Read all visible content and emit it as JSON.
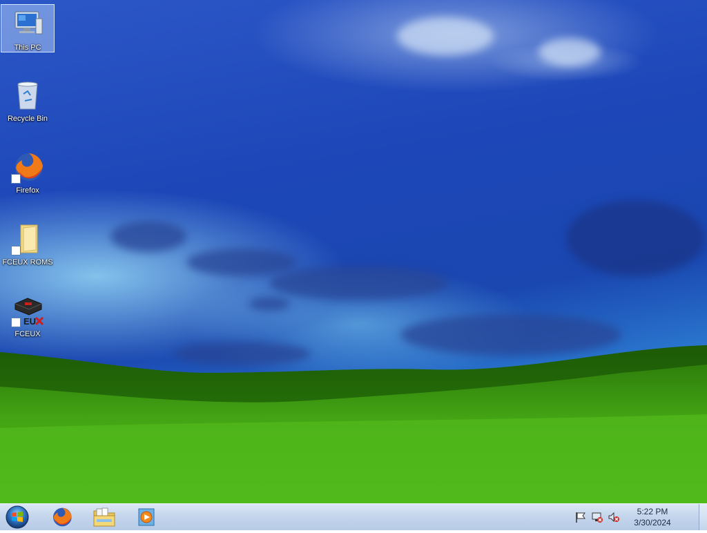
{
  "desktop": {
    "icons": [
      {
        "label": "This PC",
        "icon": "computer-icon",
        "selected": true
      },
      {
        "label": "Recycle Bin",
        "icon": "recycle-bin-icon",
        "selected": false
      },
      {
        "label": "Firefox",
        "icon": "firefox-icon",
        "selected": false
      },
      {
        "label": "FCEUX ROMS",
        "icon": "folder-icon",
        "selected": false
      },
      {
        "label": "FCEUX",
        "icon": "fceux-icon",
        "selected": false
      }
    ]
  },
  "taskbar": {
    "pinned": [
      {
        "name": "firefox",
        "icon": "firefox-icon"
      },
      {
        "name": "file-explorer",
        "icon": "folder-icon"
      },
      {
        "name": "media-player",
        "icon": "media-player-icon"
      }
    ],
    "tray": {
      "icons": [
        "action-center-flag-icon",
        "network-icon",
        "volume-muted-icon"
      ],
      "time": "5:22 PM",
      "date": "3/30/2024"
    }
  },
  "colors": {
    "sky_top": "#1d47b8",
    "grass": "#3e9e12",
    "taskbar": "#c3d5ec"
  }
}
